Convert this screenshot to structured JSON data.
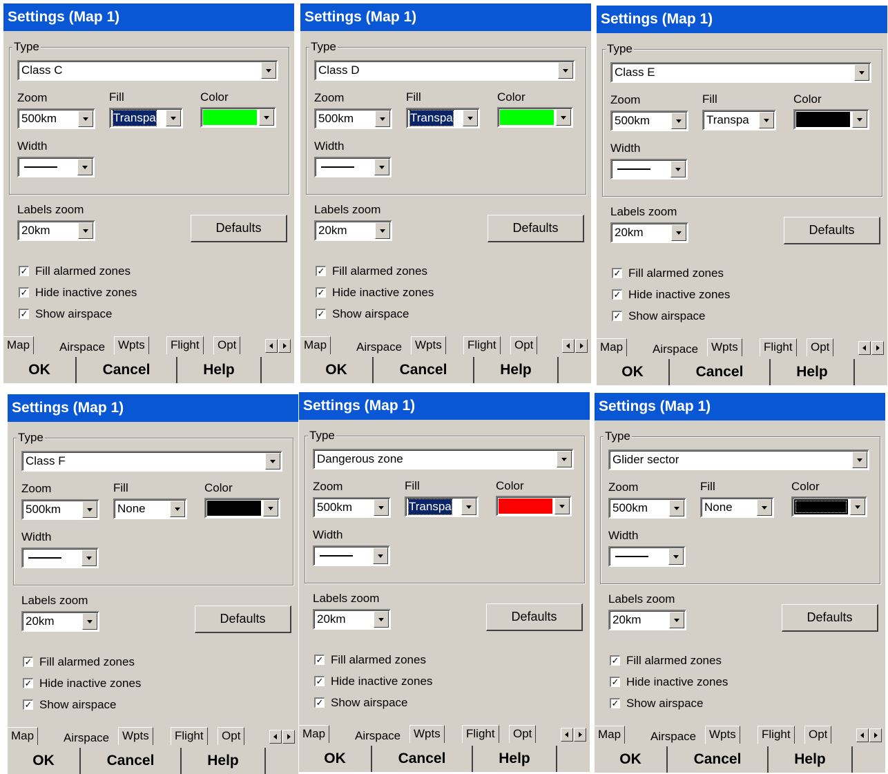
{
  "common": {
    "title": "Settings (Map 1)",
    "group_label": "Type",
    "zoom_label": "Zoom",
    "fill_label": "Fill",
    "color_label": "Color",
    "width_label": "Width",
    "zoom_value": "500km",
    "labels_zoom_label": "Labels zoom",
    "labels_zoom_value": "20km",
    "defaults_label": "Defaults",
    "checkboxes": [
      {
        "label": "Fill alarmed zones",
        "checked": true
      },
      {
        "label": "Hide inactive zones",
        "checked": true
      },
      {
        "label": "Show airspace",
        "checked": true
      }
    ],
    "check_mark": "✓",
    "tabs": [
      "Map",
      "Airspace",
      "Wpts",
      "Flight",
      "Opt"
    ],
    "active_tab": "Airspace",
    "buttons": {
      "ok": "OK",
      "cancel": "Cancel",
      "help": "Help"
    }
  },
  "panels": [
    {
      "type": "Class C",
      "fill": "Transpa",
      "fill_selected": true,
      "color": "#00ff00"
    },
    {
      "type": "Class D",
      "fill": "Transpa",
      "fill_selected": true,
      "color": "#00ff00"
    },
    {
      "type": "Class E",
      "fill": "Transpa",
      "fill_selected": false,
      "color": "#000000"
    },
    {
      "type": "Class F",
      "fill": "None",
      "fill_selected": false,
      "color": "#000000"
    },
    {
      "type": "Dangerous zone",
      "fill": "Transpa",
      "fill_selected": true,
      "color": "#ff0000"
    },
    {
      "type": "Glider sector",
      "fill": "None",
      "fill_selected": false,
      "color": "#000000",
      "color_focused": true
    }
  ],
  "colors": {
    "titlebar": "#0a57d6",
    "dialog_bg": "#d4d0c8",
    "selection": "#0a246a"
  }
}
